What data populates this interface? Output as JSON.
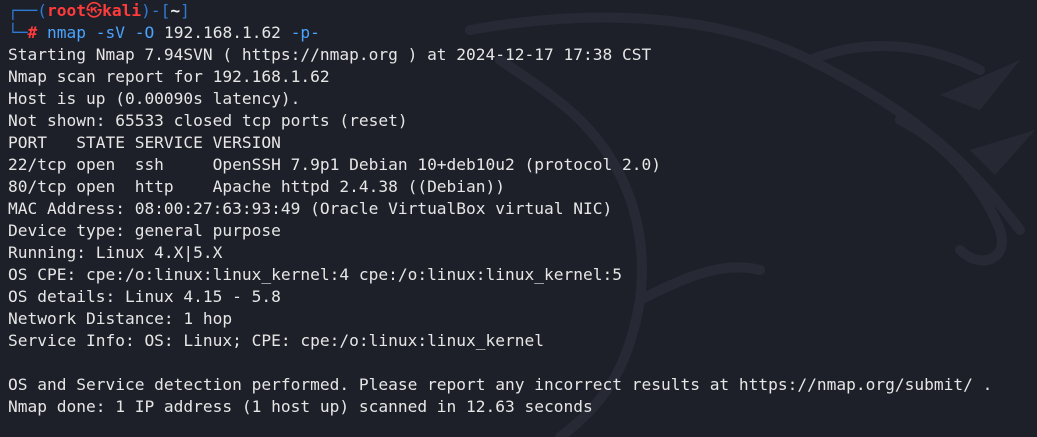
{
  "prompt": {
    "frame_open": "┌──(",
    "user": "root",
    "skull": "㉿",
    "host": "kali",
    "frame_mid": ")-[",
    "dir": "~",
    "frame_close": "]",
    "frame_second": "└─",
    "hash": "#",
    "command": "nmap",
    "flag1": "-sV",
    "flag2": "-O",
    "target": "192.168.1.62",
    "flag3": "-p-"
  },
  "output_lines": [
    "Starting Nmap 7.94SVN ( https://nmap.org ) at 2024-12-17 17:38 CST",
    "Nmap scan report for 192.168.1.62",
    "Host is up (0.00090s latency).",
    "Not shown: 65533 closed tcp ports (reset)",
    "PORT   STATE SERVICE VERSION",
    "22/tcp open  ssh     OpenSSH 7.9p1 Debian 10+deb10u2 (protocol 2.0)",
    "80/tcp open  http    Apache httpd 2.4.38 ((Debian))",
    "MAC Address: 08:00:27:63:93:49 (Oracle VirtualBox virtual NIC)",
    "Device type: general purpose",
    "Running: Linux 4.X|5.X",
    "OS CPE: cpe:/o:linux:linux_kernel:4 cpe:/o:linux:linux_kernel:5",
    "OS details: Linux 4.15 - 5.8",
    "Network Distance: 1 hop",
    "Service Info: OS: Linux; CPE: cpe:/o:linux:linux_kernel",
    "",
    "OS and Service detection performed. Please report any incorrect results at https://nmap.org/submit/ .",
    "Nmap done: 1 IP address (1 host up) scanned in 12.63 seconds"
  ],
  "colors": {
    "background": "#1e2029",
    "frame": "#2e7bd6",
    "root": "#ff3b3b",
    "command": "#4aa3ff",
    "text": "#e6e6e6"
  },
  "icons": {
    "background": "kali-dragon-logo-watermark"
  }
}
